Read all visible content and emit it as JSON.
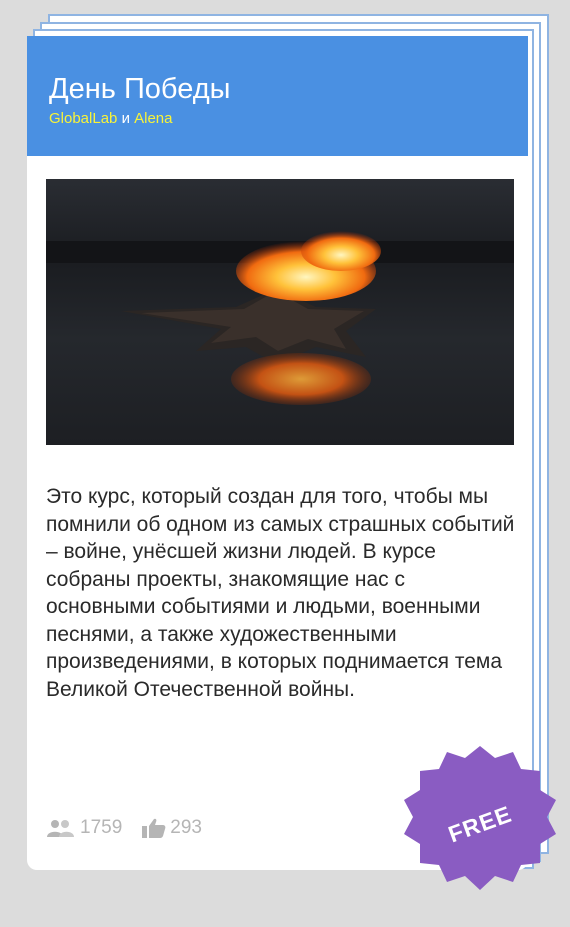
{
  "course": {
    "title": "День Победы",
    "authors": [
      {
        "name": "GlobalLab"
      },
      {
        "name": "Alena"
      }
    ],
    "author_separator": "и",
    "image_icon": "eternal-flame-star-photo",
    "description": "Это курс, который создан для того, чтобы мы помнили об одном из самых страшных событий – войне, унёсшей жизни людей. В курсе собраны проекты, знакомящие нас с основными событиями и людьми, военными песнями, а также художественными произведениями, в которых поднимается тема Великой Отечественной войны.",
    "stats": {
      "participants": "1759",
      "participants_icon": "users-icon",
      "likes": "293",
      "likes_icon": "thumbs-up-icon"
    },
    "badge": {
      "label": "FREE",
      "color": "#8a5cc2"
    }
  },
  "colors": {
    "header": "#4a90e2",
    "author_link": "#f7f33a",
    "stack_border": "#8fb4e2",
    "stat_text": "#b5b5b5"
  }
}
